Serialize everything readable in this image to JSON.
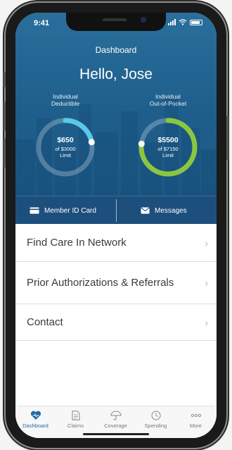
{
  "status_bar": {
    "time": "9:41"
  },
  "header": {
    "title": "Dashboard",
    "greeting": "Hello, Jose"
  },
  "gauges": [
    {
      "label_line1": "Individual",
      "label_line2": "Deductible",
      "amount": "$650",
      "of_line": "of $3000",
      "limit_label": "Limit",
      "progress": 0.22,
      "color": "#5bc8e8"
    },
    {
      "label_line1": "Individual",
      "label_line2": "Out-of-Pocket",
      "amount": "$5500",
      "of_line": "of $7150",
      "limit_label": "Limit",
      "progress": 0.77,
      "color": "#8cc63f"
    }
  ],
  "actions": {
    "member_id": "Member ID Card",
    "messages": "Messages"
  },
  "menu": [
    {
      "label": "Find Care In Network"
    },
    {
      "label": "Prior Authorizations & Referrals"
    },
    {
      "label": "Contact"
    }
  ],
  "tabs": [
    {
      "label": "Dashboard",
      "icon": "heart-icon",
      "active": true
    },
    {
      "label": "Claims",
      "icon": "document-icon"
    },
    {
      "label": "Coverage",
      "icon": "umbrella-icon"
    },
    {
      "label": "Spending",
      "icon": "clock-icon"
    },
    {
      "label": "More",
      "icon": "dots-icon"
    }
  ],
  "colors": {
    "hero": "#1f5f8c",
    "accent": "#1f6aa5",
    "deductible_ring": "#5bc8e8",
    "oop_ring": "#8cc63f"
  }
}
